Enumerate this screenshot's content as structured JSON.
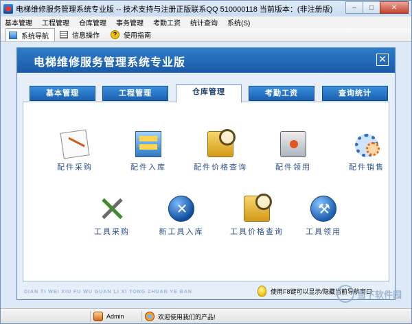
{
  "window": {
    "title": "电梯维修服务管理系统专业版 -- 技术支持与注册正版联系QQ 510000118     当前版本：(非注册版)",
    "controls": [
      "–",
      "□",
      "✕"
    ]
  },
  "menu": [
    "基本管理",
    "工程管理",
    "仓库管理",
    "事务管理",
    "考勤工资",
    "统计查询",
    "系统(S)"
  ],
  "toolbar": {
    "tabs": [
      {
        "label": "系统导航",
        "icon": "nav-icon"
      },
      {
        "label": "信息操作",
        "icon": "info-icon"
      },
      {
        "label": "使用指南",
        "icon": "help-icon"
      }
    ]
  },
  "panel": {
    "title": "电梯维修服务管理系统专业版",
    "close": "✕",
    "tabs": [
      "基本管理",
      "工程管理",
      "仓库管理",
      "考勤工资",
      "查询统计"
    ],
    "active_tab": "仓库管理",
    "row1": [
      "配件采购",
      "配件入库",
      "配件价格查询",
      "配件领用",
      "配件销售"
    ],
    "row2": [
      "工具采购",
      "新工具入库",
      "工具价格查询",
      "工具领用"
    ],
    "footer_pinyin": "DIAN TI WEI XIU FU WU GUAN LI XI TONG ZHUAN YE BAN",
    "tip": "使用F8键可以显示/隐藏当前导航窗口"
  },
  "status": {
    "user": "Admin",
    "welcome": "欢迎使用我们的产品!"
  },
  "watermark": "当下软件园"
}
